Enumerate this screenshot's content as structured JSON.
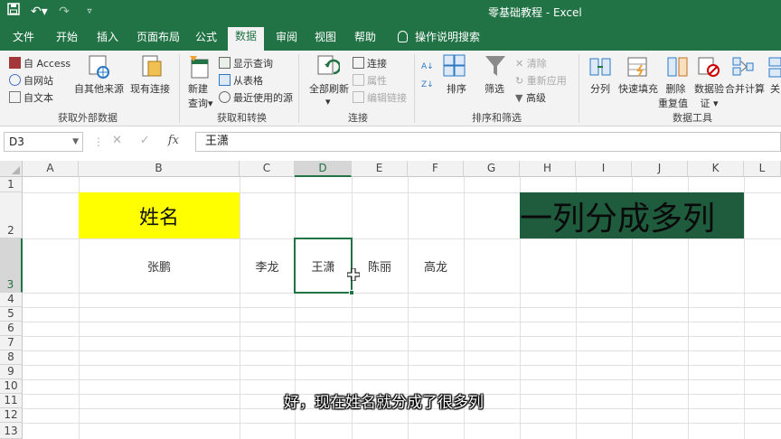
{
  "window": {
    "title": "零基础教程  -  Excel"
  },
  "tabs": [
    "文件",
    "开始",
    "插入",
    "页面布局",
    "公式",
    "数据",
    "审阅",
    "视图",
    "帮助",
    "操作说明搜索"
  ],
  "active_tab": "数据",
  "ribbon": {
    "get_external": {
      "label": "获取外部数据",
      "items": [
        "自 Access",
        "自网站",
        "自文本",
        "自其他来源",
        "现有连接"
      ]
    },
    "get_transform": {
      "label": "获取和转换",
      "new_query": [
        "新建",
        "查询"
      ],
      "items": [
        "显示查询",
        "从表格",
        "最近使用的源"
      ]
    },
    "connections": {
      "label": "连接",
      "refresh_all": "全部刷新",
      "items": [
        "连接",
        "属性",
        "编辑链接"
      ]
    },
    "sort_filter": {
      "label": "排序和筛选",
      "sort": "排序",
      "filter": "筛选",
      "items": [
        "清除",
        "重新应用",
        "高级"
      ]
    },
    "data_tools": {
      "label": "数据工具",
      "split": "分列",
      "flash_fill": "快速填充",
      "remove_dup": [
        "删除",
        "重复值"
      ],
      "validation": [
        "数据验",
        "证"
      ],
      "consolidate": "合并计算",
      "relations": "关"
    }
  },
  "formula_bar": {
    "name_box": "D3",
    "formula": "王潇"
  },
  "columns": [
    "A",
    "B",
    "C",
    "D",
    "E",
    "F",
    "G",
    "H",
    "I",
    "J",
    "K",
    "L"
  ],
  "rows": [
    "1",
    "2",
    "3",
    "4",
    "5",
    "6",
    "7",
    "8",
    "9",
    "10",
    "11",
    "12",
    "13"
  ],
  "selected": {
    "column": "D",
    "row": "3"
  },
  "cells": {
    "B2": "姓名",
    "H2": "一列分成多列",
    "B3": "张鹏",
    "C3": "李龙",
    "D3": "王潇",
    "E3": "陈丽",
    "F3": "高龙"
  },
  "colors": {
    "brand": "#217346",
    "header_fill": "#ffff00",
    "title_fill": "#1f5c3e"
  },
  "subtitle": "好，现在姓名就分成了很多列"
}
